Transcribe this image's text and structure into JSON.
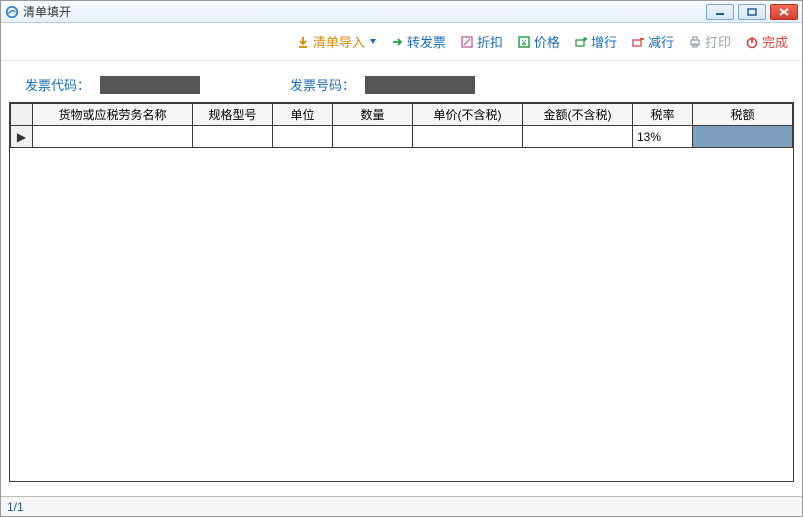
{
  "window": {
    "title": "清单填开"
  },
  "toolbar": {
    "import": "清单导入",
    "toInvoice": "转发票",
    "discount": "折扣",
    "price": "价格",
    "addRow": "增行",
    "delRow": "减行",
    "print": "打印",
    "finish": "完成"
  },
  "info": {
    "codeLabel": "发票代码：",
    "numberLabel": "发票号码："
  },
  "grid": {
    "headers": {
      "name": "货物或应税劳务名称",
      "spec": "规格型号",
      "unit": "单位",
      "qty": "数量",
      "unitPriceNoTax": "单价(不含税)",
      "amountNoTax": "金额(不含税)",
      "taxRate": "税率",
      "taxAmount": "税额"
    },
    "rows": [
      {
        "marker": "▶",
        "name": "",
        "spec": "",
        "unit": "",
        "qty": "",
        "unitPriceNoTax": "",
        "amountNoTax": "",
        "taxRate": "13%",
        "taxAmount": ""
      }
    ]
  },
  "status": {
    "page": "1/1"
  }
}
